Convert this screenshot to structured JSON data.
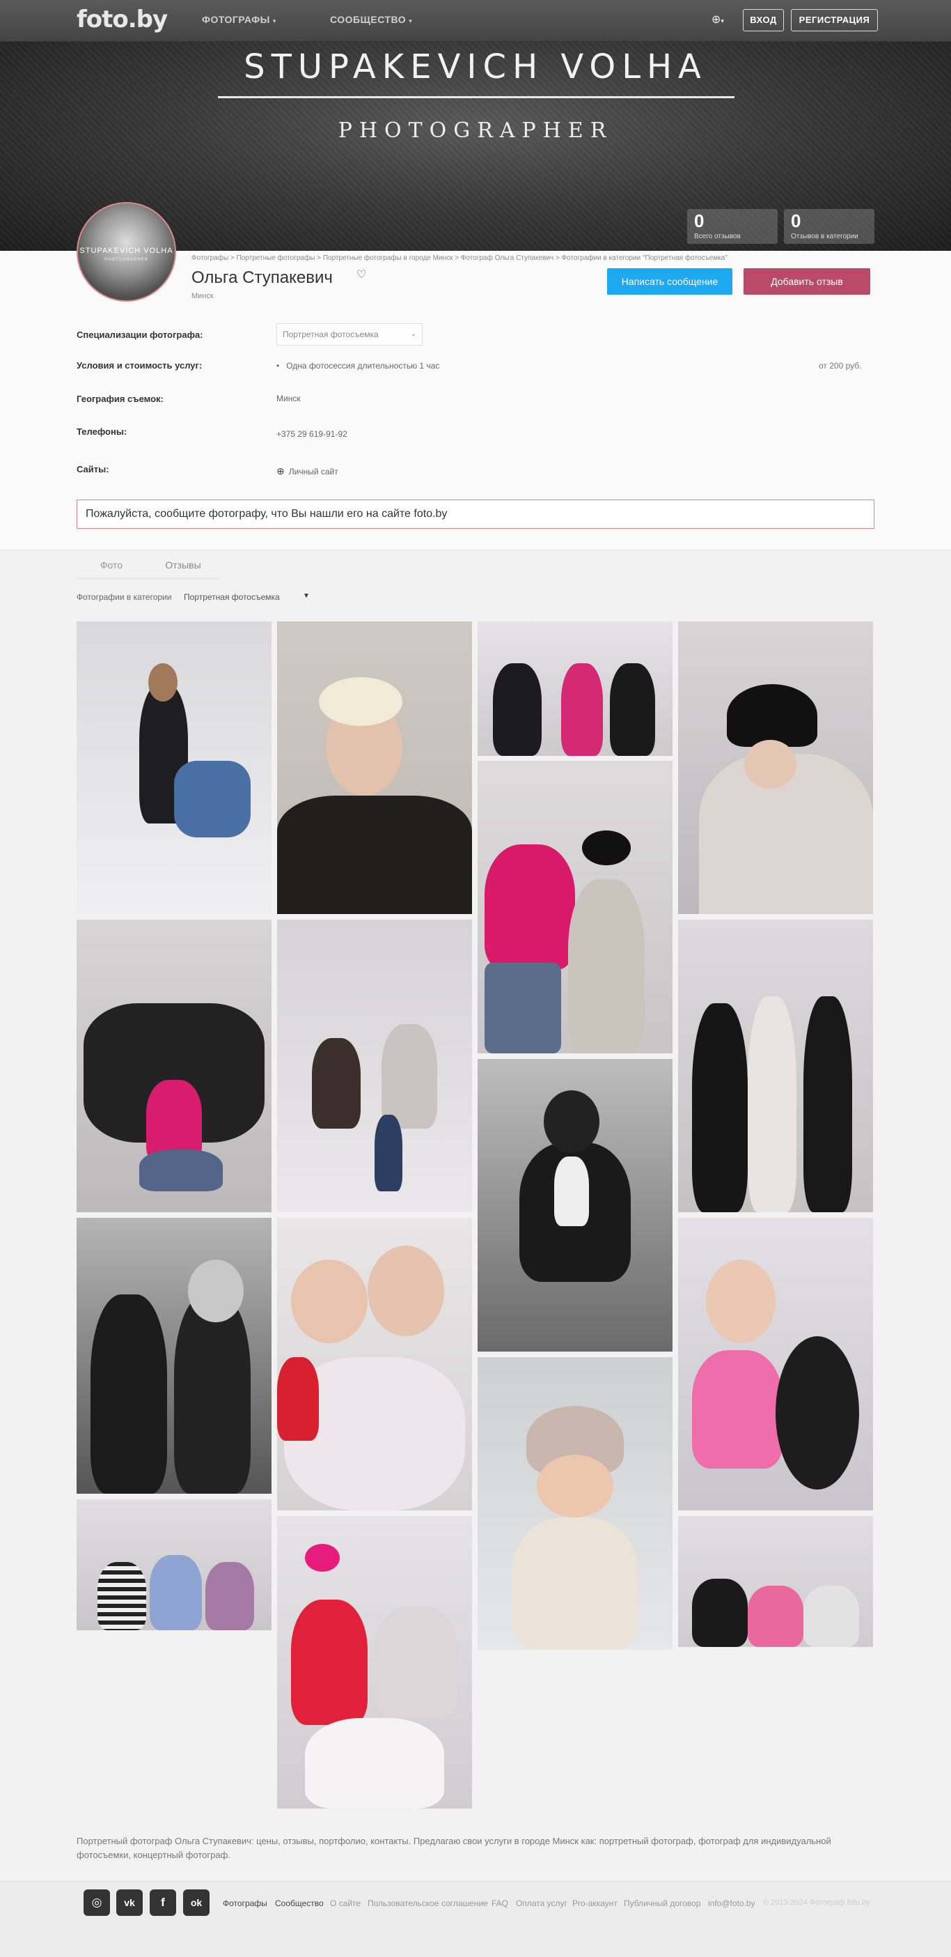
{
  "header": {
    "logo": "foto.by",
    "nav": [
      {
        "label": "ФОТОГРАФЫ"
      },
      {
        "label": "СООБЩЕСТВО"
      }
    ],
    "login": "ВХОД",
    "register": "РЕГИСТРАЦИЯ"
  },
  "banner": {
    "title": "STUPAKEVICH VOLHA",
    "subtitle": "PHOTOGRAPHER"
  },
  "counters": [
    {
      "value": "0",
      "label": "Всего отзывов"
    },
    {
      "value": "0",
      "label": "Отзывов в категории"
    }
  ],
  "avatar": {
    "title": "STUPAKEVICH VOLHA",
    "subtitle": "PHOTOGRAPHER"
  },
  "profile": {
    "breadcrumbs": "Фотографы > Портретные фотографы > Портретные фотографы в городе Минск > Фотограф Ольга Ступакевич > Фотографии в категории \"Портретная фотосъемка\"",
    "name": "Ольга Ступакевич",
    "city": "Минск",
    "message_button": "Написать сообщение",
    "review_button": "Добавить отзыв",
    "specializations_label": "Специализации фотографа:",
    "specializations_value": "Портретная фотосъемка",
    "services_label": "Условия и стоимость услуг:",
    "service_item": "Одна фотосессия длительностью 1 час",
    "service_price": "от 200 руб.",
    "geography_label": "География съемок:",
    "geography_value": "Минск",
    "phones_label": "Телефоны:",
    "phones_value": "+375 29 619-91-92",
    "sites_label": "Сайты:",
    "sites_value": "Личный сайт",
    "notice": "Пожалуйста, сообщите фотографу, что Вы нашли его на сайте foto.by"
  },
  "tabs": [
    {
      "label": "Фото"
    },
    {
      "label": "Отзывы"
    }
  ],
  "category_filter": {
    "label": "Фотографии в категории",
    "value": "Портретная фотосъемка"
  },
  "description": "Портретный фотограф Ольга Ступакевич: цены, отзывы, портфолио, контакты. Предлагаю свои услуги в городе Минск как: портретный фотограф, фотограф для индивидуальной фотосъемки, концертный фотограф.",
  "footer": {
    "social": [
      {
        "name": "instagram-icon",
        "glyph": "◎"
      },
      {
        "name": "vk-icon",
        "glyph": "vk"
      },
      {
        "name": "facebook-icon",
        "glyph": "f"
      },
      {
        "name": "odnoklassniki-icon",
        "glyph": "ok"
      }
    ],
    "links": [
      "Фотографы",
      "Сообщество",
      "О сайте",
      "Пользовательское соглашение",
      "FAQ",
      "Оплата услуг",
      "Pro-аккаунт",
      "Публичный договор",
      "info@foto.by"
    ],
    "copyright": "© 2013-2024 Фотограф foto.by"
  }
}
